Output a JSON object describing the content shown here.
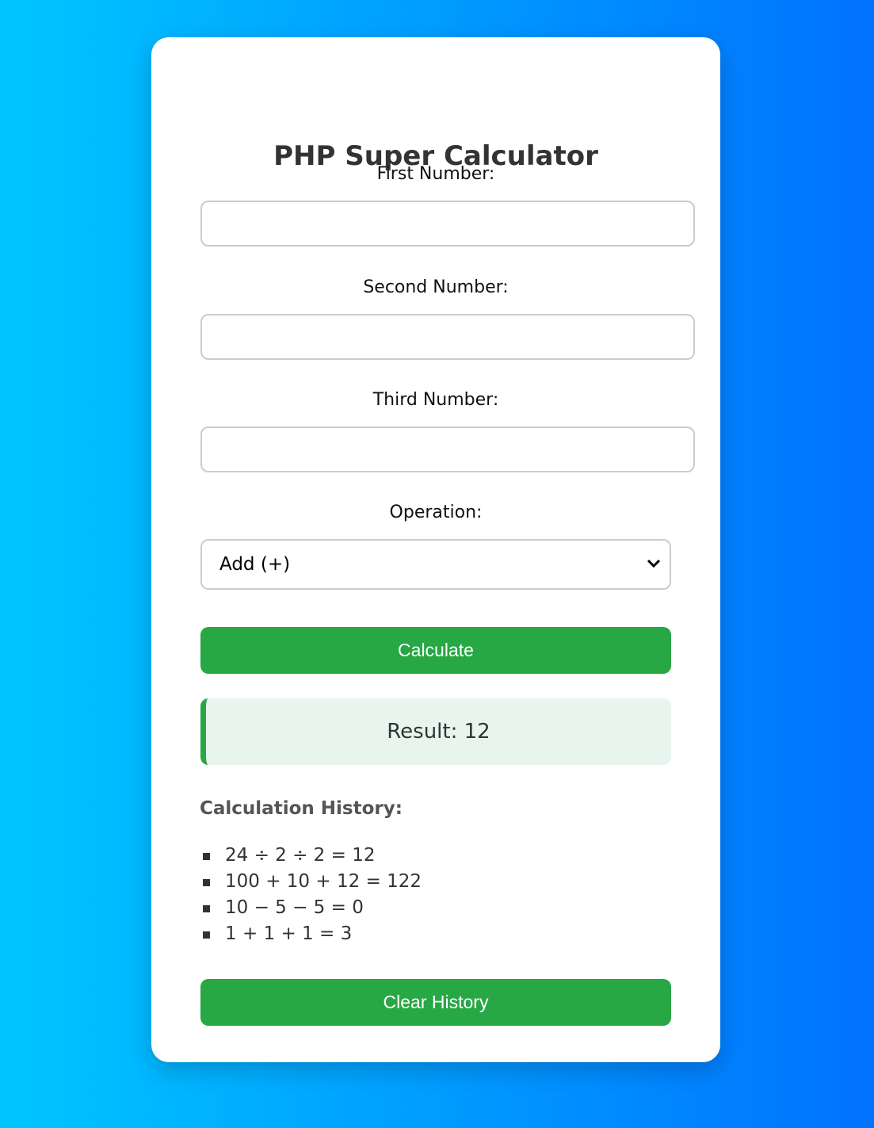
{
  "title": "PHP Super Calculator",
  "fields": [
    {
      "label": "First Number:",
      "value": ""
    },
    {
      "label": "Second Number:",
      "value": ""
    },
    {
      "label": "Third Number:",
      "value": ""
    }
  ],
  "operation": {
    "label": "Operation:",
    "selected": "Add (+)"
  },
  "calculate_label": "Calculate",
  "result": "Result: 12",
  "history": {
    "heading": "Calculation History:",
    "items": [
      "24 ÷ 2 ÷ 2 = 12",
      "100 + 10 + 12 = 122",
      "10 − 5 − 5 = 0",
      "1 + 1 + 1 = 3"
    ]
  },
  "clear_label": "Clear History",
  "colors": {
    "accent": "#28a745",
    "result_bg": "#e8f5ee"
  }
}
